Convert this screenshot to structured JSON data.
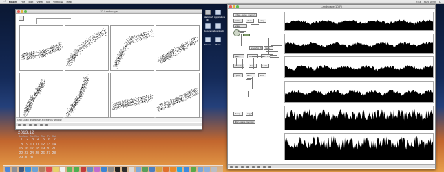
{
  "menubar": {
    "app_name": "Finder",
    "items": [
      "File",
      "Edit",
      "View",
      "Go",
      "Window",
      "Help"
    ],
    "right_items": [
      "2:44",
      "Sun 10:04",
      "Q"
    ]
  },
  "left_window": {
    "title": "1D Landscape",
    "status_text": "Grid: Draw graphics in a graphics window."
  },
  "right_window": {
    "title": "Landscape 1D Pi",
    "patch": {
      "objects": [
        "p filter~ wave, memory~",
        "metro",
        "clear",
        "bang",
        "scale",
        "snapshot 20",
        "route",
        "gate 4",
        "counter",
        "pack 0 0",
        "unpack",
        "line",
        "s plot",
        "r plot",
        "sel 0",
        "print",
        "filter~ wave, memory 10000",
        "dump",
        "toggle"
      ]
    }
  },
  "desktop_icons": [
    {
      "label": "Macintosh HD",
      "type": "hd"
    },
    {
      "label": "Applications",
      "type": "folder"
    },
    {
      "label": "Documents",
      "type": "folder"
    },
    {
      "label": "Downloads",
      "type": "folder"
    },
    {
      "label": "Pictures",
      "type": "folder"
    },
    {
      "label": "Music",
      "type": "folder"
    }
  ],
  "calendar": {
    "year_month": "2013.12",
    "weekdays": [
      "Sun",
      "Mon",
      "Tue",
      "Wed",
      "Thu",
      "Fri",
      "Sat"
    ],
    "rows": [
      [
        "1",
        "2",
        "3",
        "4",
        "5",
        "6",
        "7"
      ],
      [
        "8",
        "9",
        "10",
        "11",
        "12",
        "13",
        "14"
      ],
      [
        "15",
        "16",
        "17",
        "18",
        "19",
        "20",
        "21"
      ],
      [
        "22",
        "23",
        "24",
        "25",
        "26",
        "27",
        "28"
      ],
      [
        "29",
        "30",
        "31",
        "",
        "",
        "",
        ""
      ]
    ]
  },
  "dock": {
    "apps": [
      {
        "icon": "finder-icon",
        "color": "#4a86d8"
      },
      {
        "icon": "launchpad-icon",
        "color": "#8a8f99"
      },
      {
        "icon": "mission-control-icon",
        "color": "#3d5a80"
      },
      {
        "icon": "safari-icon",
        "color": "#3b8fd4"
      },
      {
        "icon": "mail-icon",
        "color": "#6aa3d8"
      },
      {
        "icon": "contacts-icon",
        "color": "#b08060"
      },
      {
        "icon": "calendar-icon",
        "color": "#e05050"
      },
      {
        "icon": "notes-icon",
        "color": "#e8d36a"
      },
      {
        "icon": "reminders-icon",
        "color": "#f2f2f2"
      },
      {
        "icon": "messages-icon",
        "color": "#5fb75a"
      },
      {
        "icon": "facetime-icon",
        "color": "#4caf50"
      },
      {
        "icon": "photo-booth-icon",
        "color": "#c03c3c"
      },
      {
        "icon": "iphoto-icon",
        "color": "#6b8fbf"
      },
      {
        "icon": "itunes-icon",
        "color": "#c06bd0"
      },
      {
        "icon": "app-store-icon",
        "color": "#3a84d6"
      },
      {
        "icon": "preferences-icon",
        "color": "#8c8c8c"
      },
      {
        "icon": "terminal-icon",
        "color": "#222222"
      },
      {
        "icon": "max-icon",
        "color": "#2c2c2c"
      },
      {
        "icon": "textedit-icon",
        "color": "#dcdcdc"
      },
      {
        "icon": "preview-icon",
        "color": "#7ea9d8"
      },
      {
        "icon": "activity-icon",
        "color": "#5a9e5a"
      },
      {
        "icon": "xcode-icon",
        "color": "#4b7fc1"
      },
      {
        "icon": "chrome-icon",
        "color": "#d9a441"
      },
      {
        "icon": "firefox-icon",
        "color": "#e0702c"
      },
      {
        "icon": "vlc-icon",
        "color": "#e88a2a"
      },
      {
        "icon": "skype-icon",
        "color": "#2aa4e0"
      },
      {
        "icon": "dropbox-icon",
        "color": "#3d8ae0"
      },
      {
        "icon": "evernote-icon",
        "color": "#5aa947"
      },
      {
        "icon": "folder-icon",
        "color": "#7aa6d8"
      },
      {
        "icon": "downloads-icon",
        "color": "#8cb0dc"
      },
      {
        "icon": "trash-icon",
        "color": "#b9bec6"
      }
    ]
  },
  "colors": {
    "desktop_top": "#0a1630",
    "desktop_bottom": "#e8a04a",
    "window_bg": "#ffffff",
    "plot_ink": "#000000",
    "cable": "#777777"
  }
}
